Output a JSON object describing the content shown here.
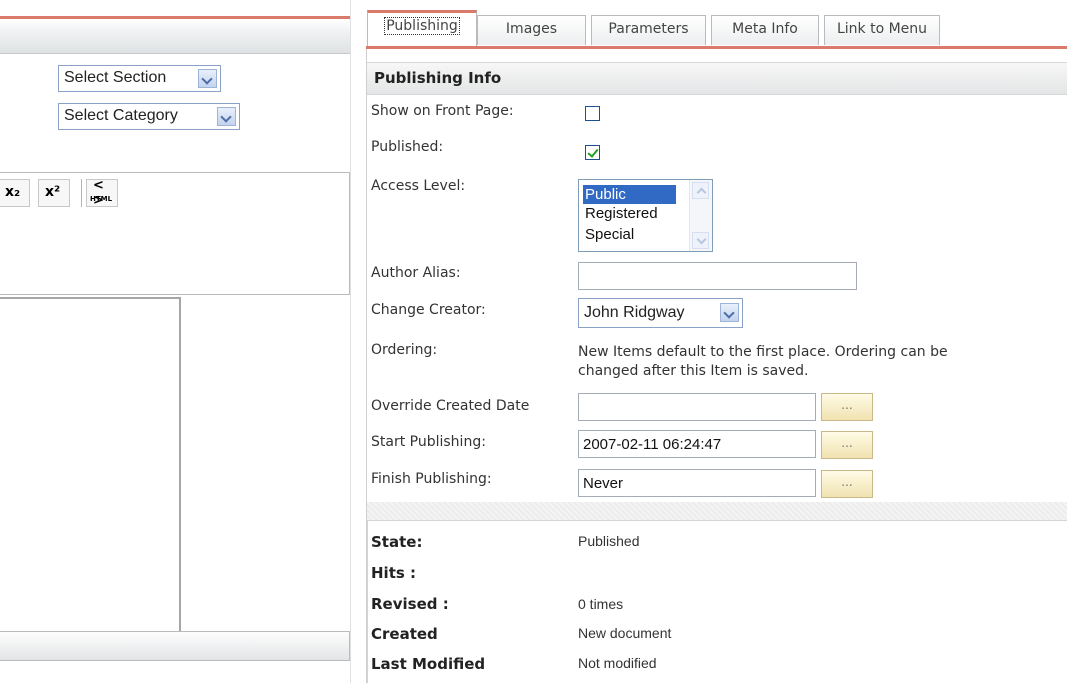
{
  "left": {
    "section_select": "Select Section",
    "category_select": "Select Category",
    "toolbar": {
      "subscript": "x₂",
      "superscript": "x²",
      "html_label": "HTML",
      "html_glyph": "< >"
    }
  },
  "tabs": [
    "Publishing",
    "Images",
    "Parameters",
    "Meta Info",
    "Link to Menu"
  ],
  "publishing": {
    "heading": "Publishing Info",
    "show_front_page_label": "Show on Front Page:",
    "show_front_page_checked": false,
    "published_label": "Published:",
    "published_checked": true,
    "access_level_label": "Access Level:",
    "access_options": [
      "Public",
      "Registered",
      "Special"
    ],
    "access_selected": "Public",
    "author_alias_label": "Author Alias:",
    "author_alias_value": "",
    "change_creator_label": "Change Creator:",
    "creator_value": "John Ridgway",
    "ordering_label": "Ordering:",
    "ordering_note_line1": "New Items default to the first place. Ordering can be",
    "ordering_note_line2": "changed after this Item is saved.",
    "override_created_label": "Override Created Date",
    "override_created_value": "",
    "start_publishing_label": "Start Publishing:",
    "start_publishing_value": "2007-02-11 06:24:47",
    "finish_publishing_label": "Finish Publishing:",
    "finish_publishing_value": "Never",
    "calendar_button_label": "..."
  },
  "info": {
    "state_label": "State:",
    "state_value": "Published",
    "hits_label": "Hits :",
    "hits_value": "",
    "revised_label": "Revised :",
    "revised_value": "0 times",
    "created_label": "Created",
    "created_value": "New document",
    "modified_label": "Last Modified",
    "modified_value": "Not modified"
  },
  "colors": {
    "accent": "#d97a6b",
    "select_highlight": "#316ac5",
    "check": "#21a121"
  }
}
